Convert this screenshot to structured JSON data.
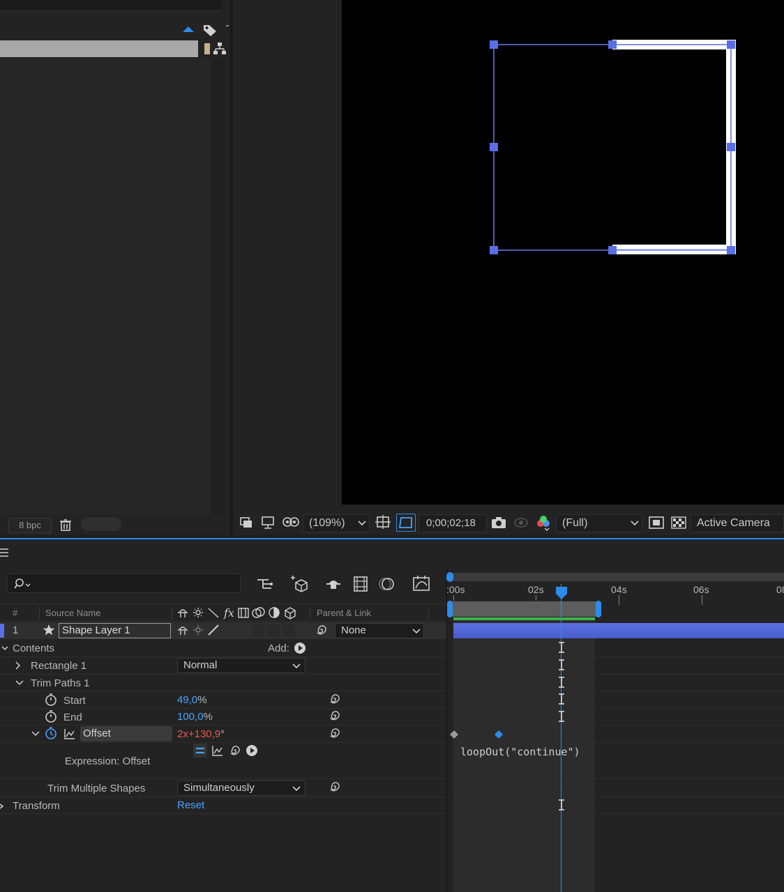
{
  "project_panel": {
    "bpc": "8 bpc",
    "icons": [
      "sort-up-icon",
      "label-tag-icon",
      "swatch-icon",
      "flowchart-icon",
      "trash-icon"
    ]
  },
  "viewer": {
    "zoom": "(109%)",
    "timecode": "0;00;02;18",
    "resolution": "(Full)",
    "camera": "Active Camera"
  },
  "timeline": {
    "columns": {
      "num": "#",
      "source_name": "Source Name",
      "parent_link": "Parent & Link"
    },
    "layer": {
      "index": "1",
      "name": "Shape Layer 1",
      "parent": "None"
    },
    "contents_label": "Contents",
    "add_label": "Add:",
    "rectangle": {
      "label": "Rectangle 1",
      "blend_mode": "Normal"
    },
    "trim_paths": {
      "label": "Trim Paths 1",
      "start_label": "Start",
      "start_value": "49,0",
      "start_unit": "%",
      "end_label": "End",
      "end_value": "100,0",
      "end_unit": "%",
      "offset_label": "Offset",
      "offset_rev": "2x",
      "offset_deg": "+130,9",
      "offset_unit": "°",
      "expression_label": "Expression: Offset",
      "expression": "loopOut(\"continue\")",
      "trim_multiple_label": "Trim Multiple Shapes",
      "trim_multiple_value": "Simultaneously"
    },
    "transform": {
      "label": "Transform",
      "reset": "Reset"
    },
    "ruler": {
      "labels": [
        ":00s",
        "02s",
        "04s",
        "06s",
        "08"
      ]
    }
  }
}
